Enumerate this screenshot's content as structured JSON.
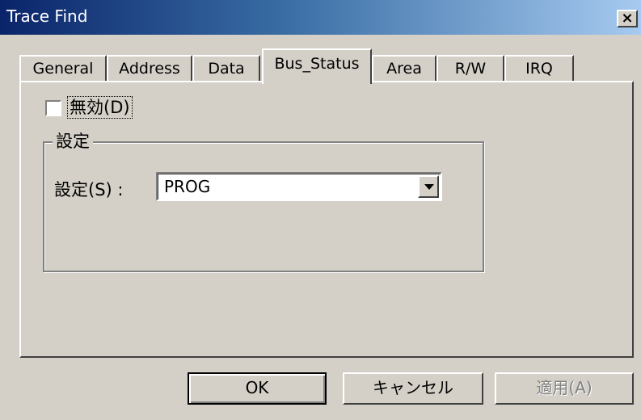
{
  "window": {
    "title": "Trace Find",
    "close_glyph": "×"
  },
  "tabs": [
    {
      "label": "General"
    },
    {
      "label": "Address"
    },
    {
      "label": "Data"
    },
    {
      "label": "Bus_Status",
      "active": true
    },
    {
      "label": "Area"
    },
    {
      "label": "R/W"
    },
    {
      "label": "IRQ"
    }
  ],
  "panel": {
    "disable_checkbox": {
      "label": "無効(D)",
      "checked": false
    },
    "settings_group": {
      "title": "設定",
      "setting_label": "設定(S) :",
      "setting_value": "PROG"
    }
  },
  "buttons": {
    "ok": "OK",
    "cancel": "キャンセル",
    "apply": "適用(A)"
  }
}
